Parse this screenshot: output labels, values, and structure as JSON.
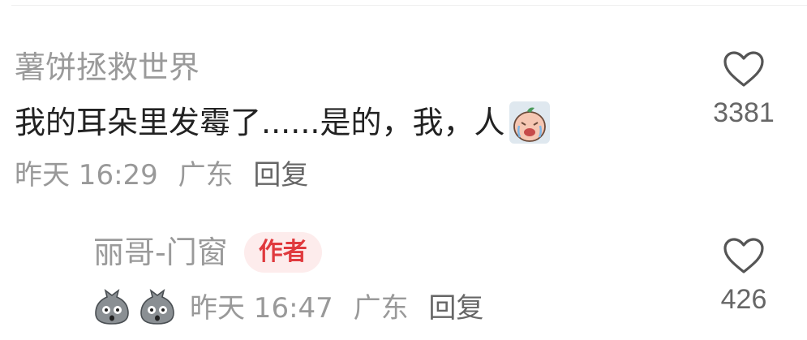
{
  "comment": {
    "author": "薯饼拯救世界",
    "text": "我的耳朵里发霉了......是的，我，人",
    "sticker_icon": "crying-peach-emoji",
    "time": "昨天 16:29",
    "location": "广东",
    "reply_label": "回复",
    "like_count": "3381"
  },
  "reply": {
    "author": "丽哥-门窗",
    "badge": "作者",
    "stickers": [
      "shocked-bag-emoji",
      "shocked-bag-emoji"
    ],
    "time": "昨天 16:47",
    "location": "广东",
    "reply_label": "回复",
    "like_count": "426"
  },
  "colors": {
    "author": "#9a9a9a",
    "text": "#222222",
    "meta": "#999999",
    "badge_bg": "#fdecec",
    "badge_text": "#e03a3e"
  }
}
